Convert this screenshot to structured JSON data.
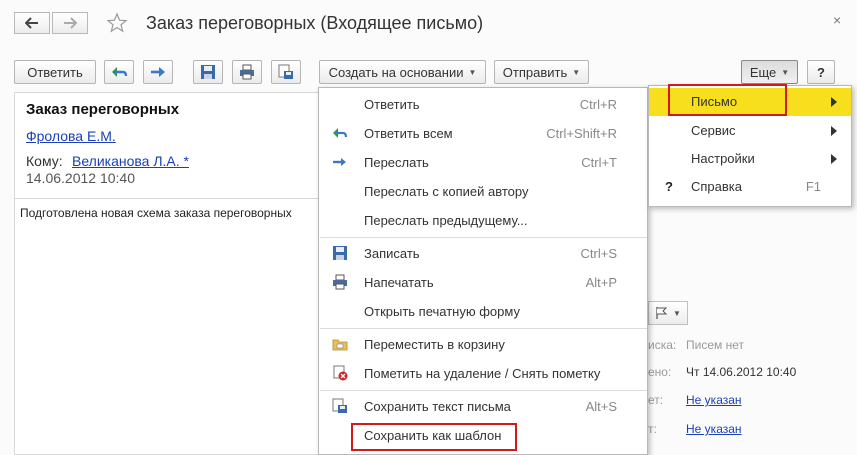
{
  "window": {
    "title": "Заказ переговорных (Входящее письмо)",
    "close_glyph": "×"
  },
  "toolbar": {
    "reply_label": "Ответить",
    "create_based_label": "Создать на основании",
    "send_label": "Отправить",
    "more_label": "Еще",
    "help_label": "?"
  },
  "document": {
    "subject": "Заказ переговорных",
    "from": "Фролова Е.М.",
    "to_label": "Кому:",
    "to": "Великанова Л.А. *",
    "date": "14.06.2012 10:40",
    "body": "Подготовлена новая схема заказа переговорных"
  },
  "right_panel": {
    "ska_label": "иска:",
    "ska_value": "Писем нет",
    "eno_label": "ено:",
    "eno_value": "Чт 14.06.2012 10:40",
    "et_label": "ет:",
    "et_value": "Не указан",
    "t_label": "т:",
    "t_value": "Не указан"
  },
  "menu": {
    "items": [
      {
        "label": "Ответить",
        "shortcut": "Ctrl+R",
        "icon": "none"
      },
      {
        "label": "Ответить всем",
        "shortcut": "Ctrl+Shift+R",
        "icon": "reply-all-icon"
      },
      {
        "label": "Переслать",
        "shortcut": "Ctrl+T",
        "icon": "forward-icon"
      },
      {
        "label": "Переслать с копией автору",
        "shortcut": "",
        "icon": "none"
      },
      {
        "label": "Переслать предыдущему...",
        "shortcut": "",
        "icon": "none"
      },
      {
        "label": "Записать",
        "shortcut": "Ctrl+S",
        "icon": "save-icon"
      },
      {
        "label": "Напечатать",
        "shortcut": "Alt+P",
        "icon": "print-icon"
      },
      {
        "label": "Открыть печатную форму",
        "shortcut": "",
        "icon": "none"
      },
      {
        "label": "Переместить в корзину",
        "shortcut": "",
        "icon": "trash-folder-icon"
      },
      {
        "label": "Пометить на удаление / Снять пометку",
        "shortcut": "",
        "icon": "delete-mark-icon"
      },
      {
        "label": "Сохранить текст письма",
        "shortcut": "Alt+S",
        "icon": "save-text-icon"
      },
      {
        "label": "Сохранить как шаблон",
        "shortcut": "",
        "icon": "none"
      }
    ]
  },
  "submenu": {
    "items": [
      {
        "label": "Письмо",
        "shortcut": "",
        "has_arrow": true,
        "highlighted": true
      },
      {
        "label": "Сервис",
        "shortcut": "",
        "has_arrow": true
      },
      {
        "label": "Настройки",
        "shortcut": "",
        "has_arrow": true
      },
      {
        "label": "Справка",
        "shortcut": "F1",
        "prefix": "?"
      }
    ]
  },
  "colors": {
    "highlight": "#f7df1e",
    "annotation_red": "#d11a1a",
    "link_blue": "#1a3fb8",
    "icon_blue": "#3a78c8",
    "icon_green": "#2e9a3a"
  }
}
